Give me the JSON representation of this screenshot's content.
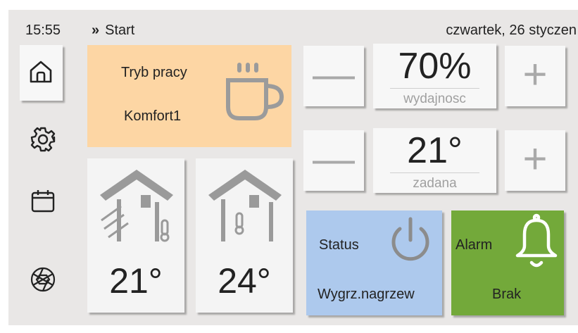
{
  "header": {
    "time": "15:55",
    "breadcrumb_chevron": "»",
    "breadcrumb": "Start",
    "date": "czwartek, 26 styczen"
  },
  "sidebar": {
    "items": [
      {
        "icon": "home-icon",
        "active": true
      },
      {
        "icon": "gear-icon",
        "active": false
      },
      {
        "icon": "calendar-icon",
        "active": false
      },
      {
        "icon": "aperture-icon",
        "active": false
      }
    ]
  },
  "mode": {
    "label": "Tryb pracy",
    "value": "Komfort1",
    "icon": "coffee-cup-icon",
    "color": "#fdd6a4"
  },
  "temperatures": [
    {
      "icon": "house-airflow-thermometer-icon",
      "value": "21°"
    },
    {
      "icon": "house-thermometer-icon",
      "value": "24°"
    }
  ],
  "efficiency": {
    "value": "70%",
    "label": "wydajnosc",
    "minus": "—",
    "plus": "+"
  },
  "setpoint": {
    "value": "21°",
    "label": "zadana",
    "minus": "—",
    "plus": "+"
  },
  "status": {
    "label": "Status",
    "value": "Wygrz.nagrzew",
    "icon": "power-icon",
    "color": "#adc9ed"
  },
  "alarm": {
    "label": "Alarm",
    "value": "Brak",
    "icon": "bell-icon",
    "color": "#73a93a"
  }
}
